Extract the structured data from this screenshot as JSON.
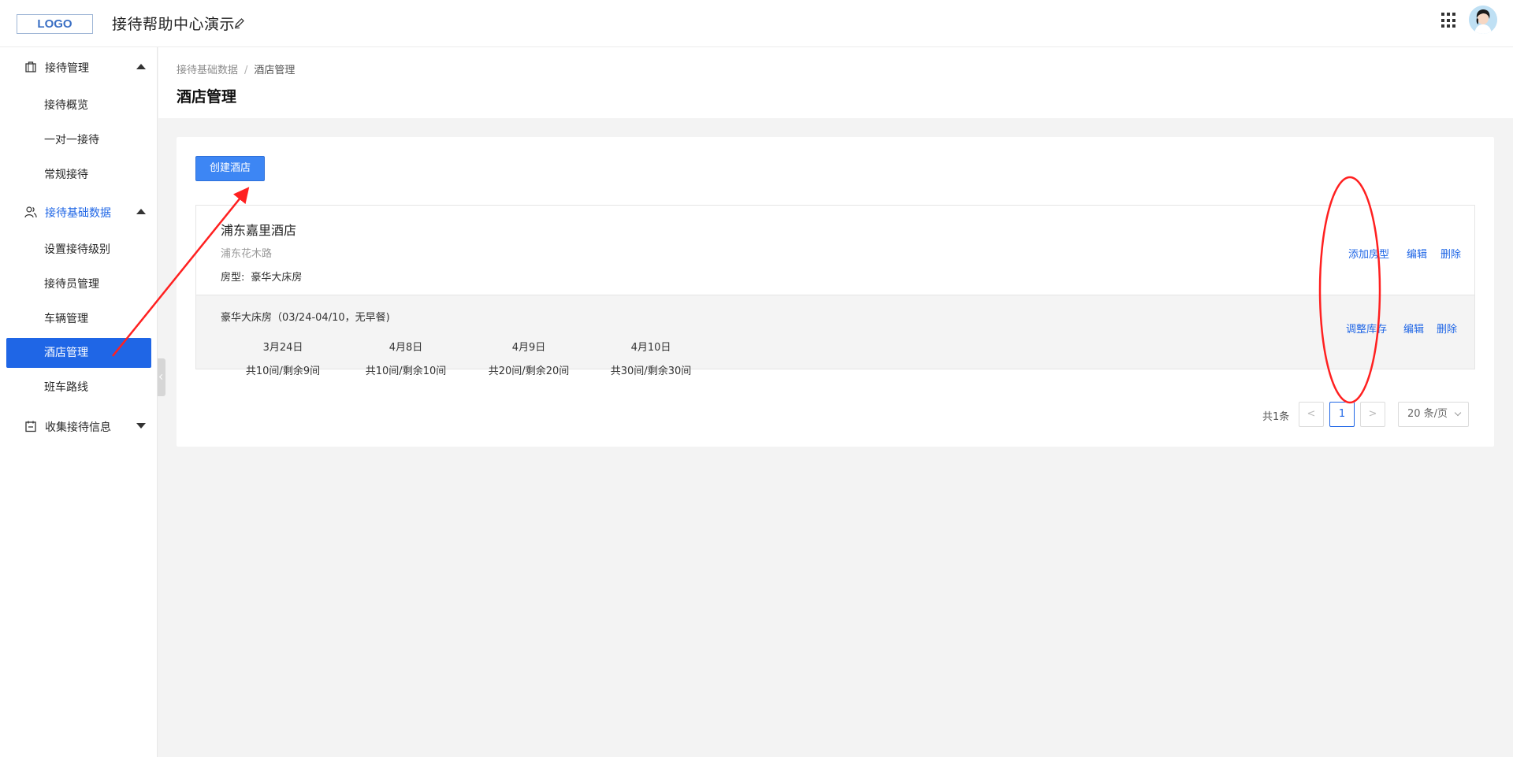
{
  "header": {
    "logo_text": "LOGO",
    "app_title": "接待帮助中心演示",
    "icons": [
      "edit-icon",
      "apps-grid-icon",
      "avatar"
    ]
  },
  "sidebar": {
    "groups": [
      {
        "label": "接待管理",
        "icon": "briefcase-icon",
        "expanded": true,
        "items": [
          {
            "label": "接待概览"
          },
          {
            "label": "一对一接待"
          },
          {
            "label": "常规接待"
          }
        ]
      },
      {
        "label": "接待基础数据",
        "icon": "users-icon",
        "expanded": true,
        "active": true,
        "items": [
          {
            "label": "设置接待级别"
          },
          {
            "label": "接待员管理"
          },
          {
            "label": "车辆管理"
          },
          {
            "label": "酒店管理",
            "selected": true
          },
          {
            "label": "班车路线"
          }
        ]
      },
      {
        "label": "收集接待信息",
        "icon": "calendar-icon",
        "expanded": false,
        "items": []
      }
    ]
  },
  "breadcrumb": {
    "parent": "接待基础数据",
    "separator": "/",
    "current": "酒店管理"
  },
  "page_title": "酒店管理",
  "toolbar": {
    "create_label": "创建酒店"
  },
  "hotel": {
    "name": "浦东嘉里酒店",
    "address": "浦东花木路",
    "room_type_label": "房型:",
    "room_type_value": "豪华大床房",
    "actions": {
      "add_room_type": "添加房型",
      "edit": "编辑",
      "delete": "删除"
    },
    "room": {
      "summary": "豪华大床房（03/24-04/10，无早餐)",
      "actions": {
        "adjust_stock": "调整库存",
        "edit": "编辑",
        "delete": "删除"
      },
      "dates": [
        {
          "date": "3月24日",
          "stock": "共10间/剩余9间"
        },
        {
          "date": "4月8日",
          "stock": "共10间/剩余10间"
        },
        {
          "date": "4月9日",
          "stock": "共20间/剩余20间"
        },
        {
          "date": "4月10日",
          "stock": "共30间/剩余30间"
        }
      ]
    }
  },
  "pagination": {
    "total": "共1条",
    "prev": "<",
    "current_page": "1",
    "next": ">",
    "page_size": "20 条/页"
  },
  "colors": {
    "primary": "#1f66e6",
    "button": "#3d86f4",
    "annotation": "#ff2020"
  }
}
